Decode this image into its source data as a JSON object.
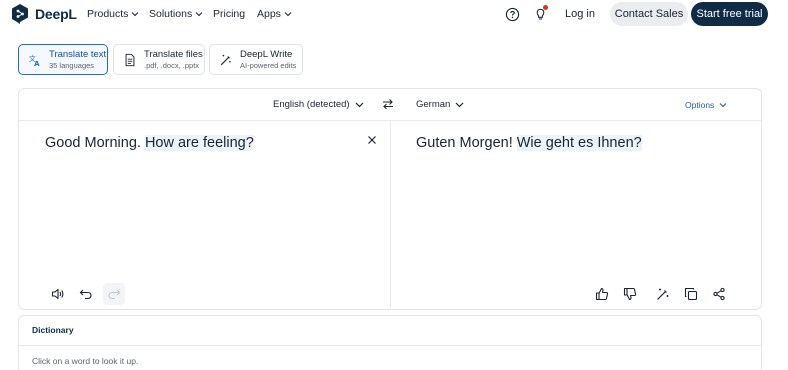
{
  "nav": {
    "brand": "DeepL",
    "products": "Products",
    "solutions": "Solutions",
    "pricing": "Pricing",
    "apps": "Apps",
    "login": "Log in",
    "contact_sales": "Contact Sales",
    "start_trial": "Start free trial",
    "icons": [
      "help-circle-icon",
      "lightbulb-icon"
    ],
    "notification_color": "#e0301e"
  },
  "modes": [
    {
      "title": "Translate text",
      "subtitle": "35 languages",
      "icon": "translate-icon",
      "active": true
    },
    {
      "title": "Translate files",
      "subtitle": ".pdf, .docx, .pptx",
      "icon": "document-icon",
      "active": false
    },
    {
      "title": "DeepL Write",
      "subtitle": "AI-powered edits",
      "icon": "magic-pen-icon",
      "active": false
    }
  ],
  "translator": {
    "source_lang": "English (detected)",
    "target_lang": "German",
    "options_label": "Options",
    "source_plain": "Good Morning. ",
    "source_highlight": "How are feeling?",
    "target_plain": "Guten Morgen! ",
    "target_highlight": "Wie geht es Ihnen?"
  },
  "dictionary": {
    "title": "Dictionary",
    "hint": "Click on a word to look it up."
  },
  "colors": {
    "brand_navy": "#0f2b46",
    "accent_blue": "#1f6fc3",
    "highlight": "#edf3fa"
  }
}
